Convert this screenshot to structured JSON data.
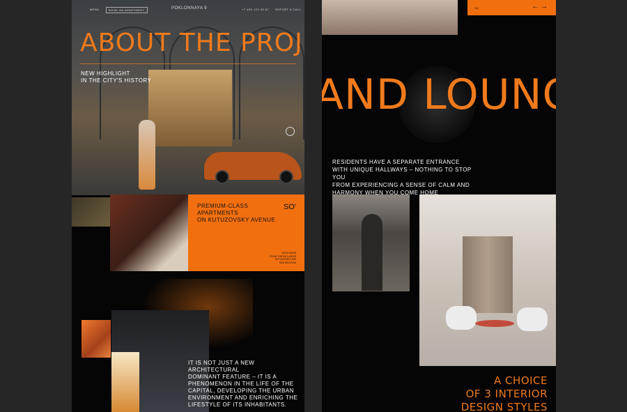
{
  "left": {
    "nav": {
      "menu": "MENU",
      "cta": "BOOK AN APARTMENT",
      "brand": "POKLONNAYA 9",
      "phone": "+7 495 123 45 67",
      "lang": "REPORT A CALL"
    },
    "hero": {
      "title": "ABOUT THE PROJECT",
      "subtitle_line1": "NEW HIGHLIGHT",
      "subtitle_line2": "IN THE CITY'S HISTORY"
    },
    "feature": {
      "line1": "PREMIUM-CLASS",
      "line2": "APARTMENTS",
      "line3": "ON KUTUZOVSKY AVENUE",
      "logo": "SO'",
      "note1": "WITH VIEWS",
      "note2": "FROM THE EXCLUSIVE",
      "note3": "KUTUZOVSKY AVE",
      "note4": "AND MOSCOW"
    },
    "description": {
      "line1": "IT IS NOT JUST A NEW ARCHITECTURAL",
      "line2": "DOMINANT FEATURE – IT IS A",
      "line3": "PHENOMENON IN THE LIFE OF THE",
      "line4": "CAPITAL, DEVELOPING THE URBAN",
      "line5": "ENVIRONMENT AND ENRICHING THE",
      "line6": "LIFESTYLE OF ITS INHABITANTS."
    }
  },
  "right": {
    "pager": "1/4",
    "arrows": "← →",
    "title": "AND LOUNGE",
    "para": {
      "line1": "RESIDENTS HAVE A SEPARATE ENTRANCE",
      "line2": "WITH UNIQUE HALLWAYS – NOTHING TO STOP YOU",
      "line3": "FROM EXPERIENCING A SENSE OF CALM AND",
      "line4": "HARMONY WHEN YOU COME HOME"
    },
    "choice": {
      "line1": "A CHOICE",
      "line2": "OF 3 INTERIOR",
      "line3": "DESIGN STYLES"
    }
  },
  "colors": {
    "accent": "#f26f10",
    "background": "#050505",
    "canvas": "#262626"
  }
}
